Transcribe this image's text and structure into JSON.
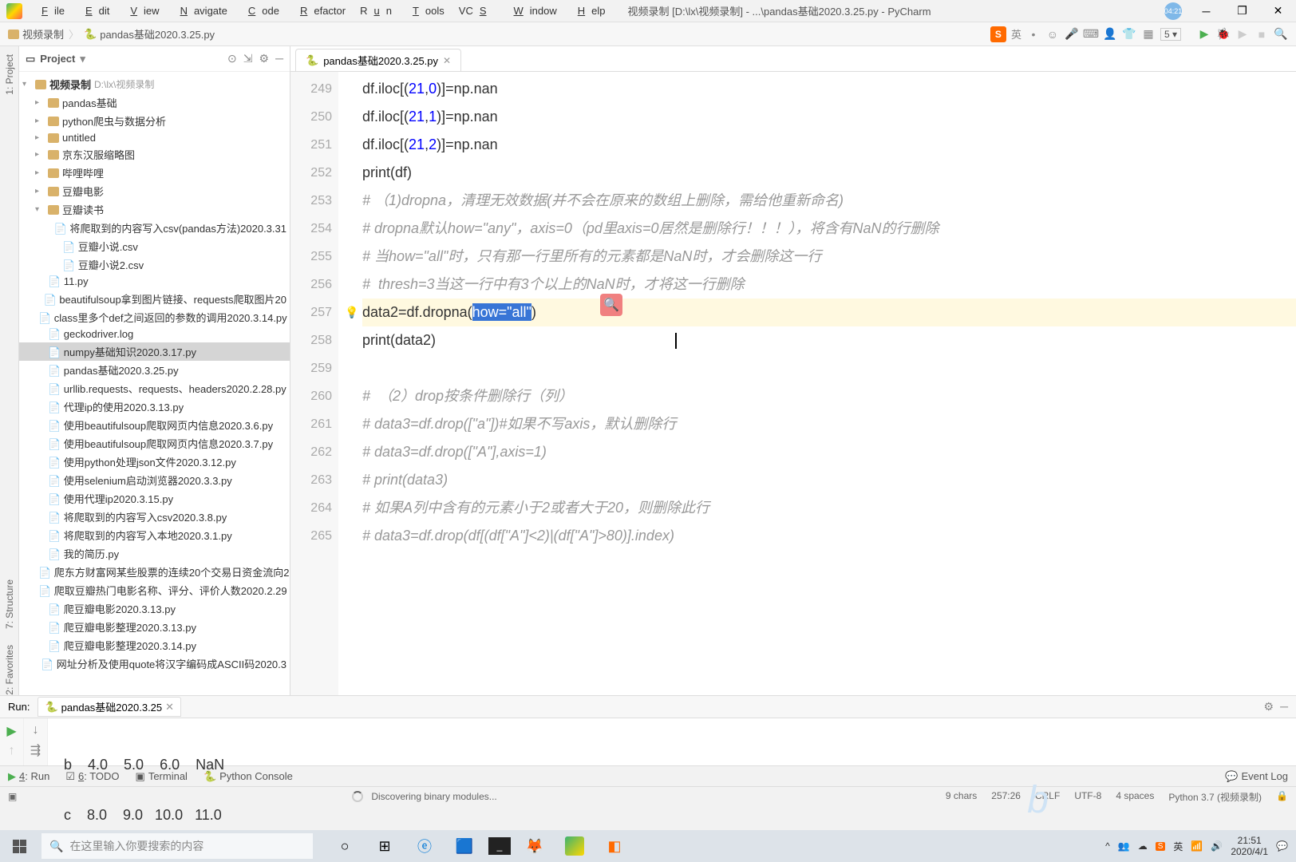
{
  "window": {
    "title": "视频录制 [D:\\lx\\视频录制] - ...\\pandas基础2020.3.25.py - PyCharm",
    "badge": "04:21"
  },
  "menu": {
    "file": "File",
    "edit": "Edit",
    "view": "View",
    "navigate": "Navigate",
    "code": "Code",
    "refactor": "Refactor",
    "run": "Run",
    "tools": "Tools",
    "vcs": "VCS",
    "window": "Window",
    "help": "Help"
  },
  "breadcrumb": {
    "root": "视频录制",
    "file": "pandas基础2020.3.25.py",
    "sogou": "S",
    "lang": "英",
    "combo": "5"
  },
  "sidebar": {
    "project_label": "1: Project",
    "structure_label": "7: Structure",
    "favorites_label": "2: Favorites"
  },
  "project": {
    "header": "Project",
    "root": "视频录制",
    "root_path": "D:\\lx\\视频录制",
    "folders": [
      "pandas基础",
      "python爬虫与数据分析",
      "untitled",
      "京东汉服缩略图",
      "哔哩哔哩",
      "豆瓣电影"
    ],
    "folder_open": "豆瓣读书",
    "folder_open_items": [
      "将爬取到的内容写入csv(pandas方法)2020.3.31",
      "豆瓣小说.csv",
      "豆瓣小说2.csv"
    ],
    "files": [
      "11.py",
      "beautifulsoup拿到图片链接、requests爬取图片20",
      "class里多个def之间返回的参数的调用2020.3.14.py",
      "geckodriver.log",
      "numpy基础知识2020.3.17.py",
      "pandas基础2020.3.25.py",
      "urllib.requests、requests、headers2020.2.28.py",
      "代理ip的使用2020.3.13.py",
      "使用beautifulsoup爬取网页内信息2020.3.6.py",
      "使用beautifulsoup爬取网页内信息2020.3.7.py",
      "使用python处理json文件2020.3.12.py",
      "使用selenium启动浏览器2020.3.3.py",
      "使用代理ip2020.3.15.py",
      "将爬取到的内容写入csv2020.3.8.py",
      "将爬取到的内容写入本地2020.3.1.py",
      "我的简历.py",
      "爬东方财富网某些股票的连续20个交易日资金流向2",
      "爬取豆瓣热门电影名称、评分、评价人数2020.2.29",
      "爬豆瓣电影2020.3.13.py",
      "爬豆瓣电影整理2020.3.13.py",
      "爬豆瓣电影整理2020.3.14.py",
      "网址分析及使用quote将汉字编码成ASCII码2020.3"
    ],
    "selected_index": 4
  },
  "editor": {
    "tab": "pandas基础2020.3.25.py",
    "line_start": 249,
    "lines": [
      {
        "n": 249,
        "t": "plain",
        "txt": "df.iloc[(21,0)]=np.nan"
      },
      {
        "n": 250,
        "t": "plain",
        "txt": "df.iloc[(21,1)]=np.nan"
      },
      {
        "n": 251,
        "t": "plain",
        "txt": "df.iloc[(21,2)]=np.nan"
      },
      {
        "n": 252,
        "t": "print",
        "call": "print",
        "arg": "df"
      },
      {
        "n": 253,
        "t": "comment",
        "txt": "# （1)dropna，清理无效数据(并不会在原来的数组上删除，需给他重新命名)"
      },
      {
        "n": 254,
        "t": "comment",
        "txt": "# dropna默认how=\"any\"，axis=0（pd里axis=0居然是删除行！！！），将含有NaN的行删除"
      },
      {
        "n": 255,
        "t": "comment",
        "txt": "# 当how=\"all\"时，只有那一行里所有的元素都是NaN时，才会删除这一行"
      },
      {
        "n": 256,
        "t": "comment",
        "txt": "#  thresh=3当这一行中有3个以上的NaN时，才将这一行删除"
      },
      {
        "n": 257,
        "t": "dropna",
        "pre": "data2=df.dropna(",
        "sel": "how=\"all\"",
        "post": ")"
      },
      {
        "n": 258,
        "t": "print",
        "call": "print",
        "arg": "data2"
      },
      {
        "n": 259,
        "t": "blank"
      },
      {
        "n": 260,
        "t": "comment",
        "txt": "#  （2）drop按条件删除行（列）"
      },
      {
        "n": 261,
        "t": "comment",
        "txt": "# data3=df.drop([\"a\"])#如果不写axis，默认删除行"
      },
      {
        "n": 262,
        "t": "comment",
        "txt": "# data3=df.drop([\"A\"],axis=1)"
      },
      {
        "n": 263,
        "t": "comment",
        "txt": "# print(data3)"
      },
      {
        "n": 264,
        "t": "comment",
        "txt": "# 如果A列中含有的元素小于2或者大于20，则删除此行"
      },
      {
        "n": 265,
        "t": "comment",
        "txt": "# data3=df.drop(df[(df[\"A\"]<2)|(df[\"A\"]>80)].index)"
      }
    ],
    "cursor_line": 258
  },
  "run": {
    "label": "Run:",
    "tab": "pandas基础2020.3.25",
    "row1": "b    4.0    5.0    6.0    NaN",
    "row2": "c    8.0    9.0   10.0   11.0"
  },
  "tools": {
    "run": "4: Run",
    "todo": "6: TODO",
    "terminal": "Terminal",
    "console": "Python Console",
    "event_log": "Event Log"
  },
  "status": {
    "msg": "Discovering binary modules...",
    "chars": "9 chars",
    "pos": "257:26",
    "crlf": "CRLF",
    "enc": "UTF-8",
    "indent": "4 spaces",
    "python": "Python 3.7 (视频录制)"
  },
  "taskbar": {
    "search_placeholder": "在这里输入你要搜索的内容",
    "time": "21:51",
    "date": "2020/4/1",
    "ime": "英"
  }
}
